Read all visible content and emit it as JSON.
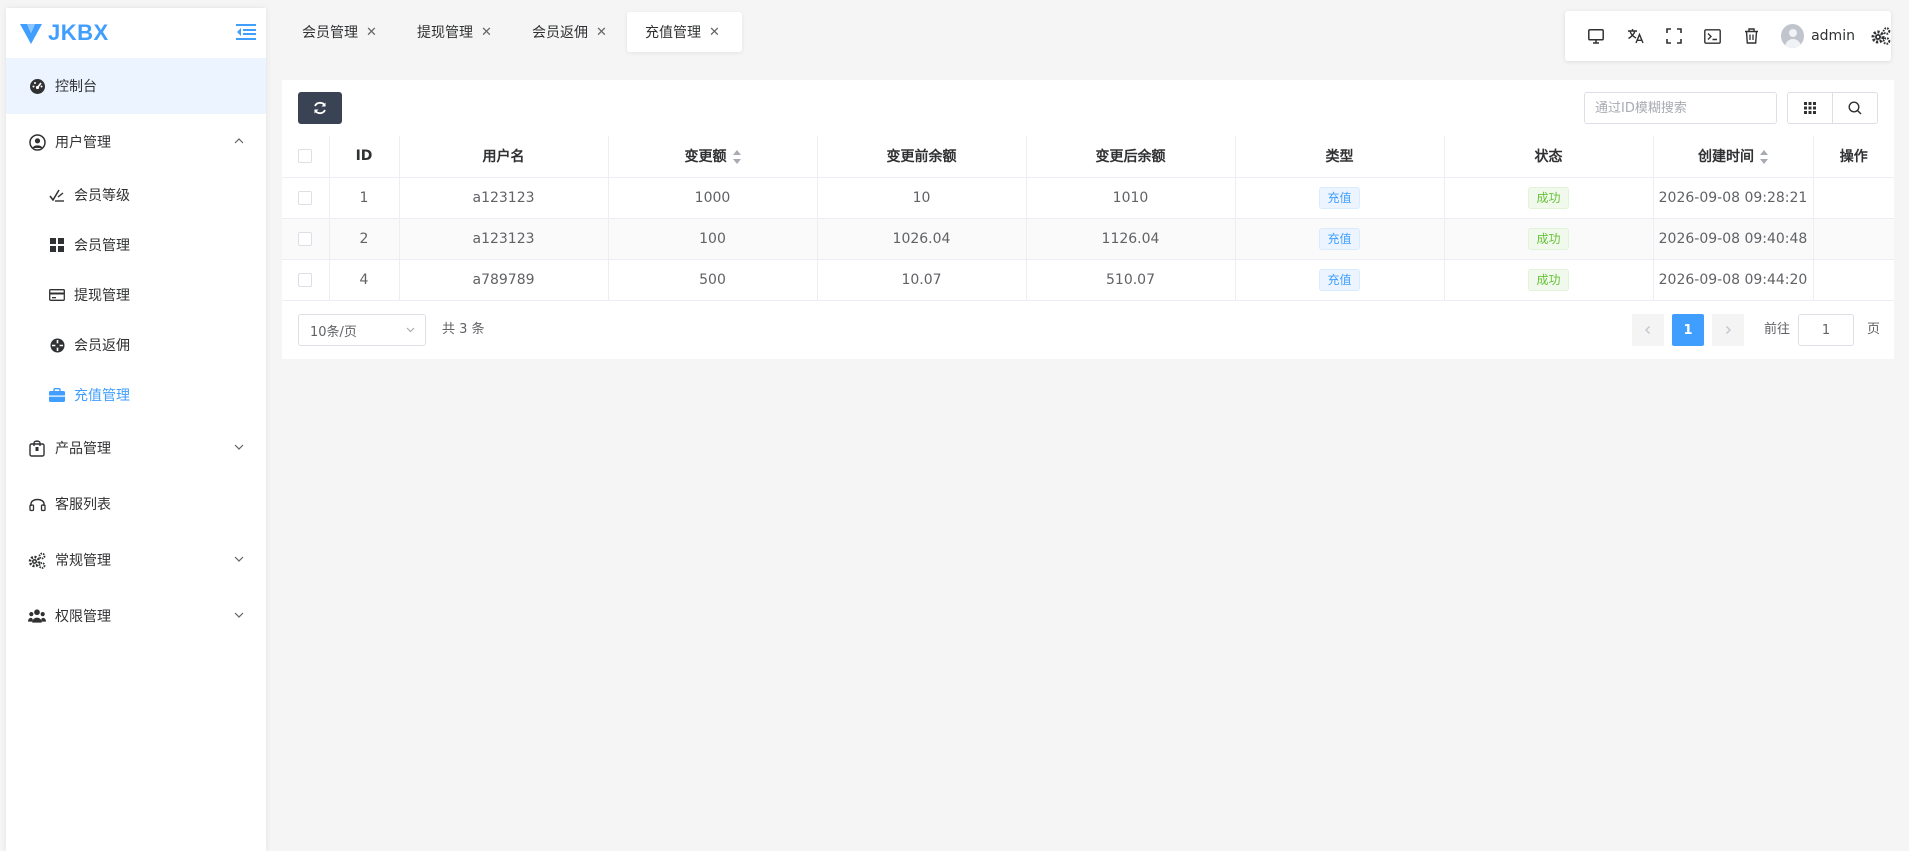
{
  "app": {
    "logo_text": "JKBX",
    "brand_color": "#409eff"
  },
  "sidebar": {
    "items": [
      {
        "label": "控制台",
        "icon": "dashboard-icon"
      },
      {
        "label": "用户管理",
        "icon": "user-circle-icon",
        "expanded": true,
        "children": [
          {
            "label": "会员等级",
            "icon": "level-icon"
          },
          {
            "label": "会员管理",
            "icon": "grid-icon"
          },
          {
            "label": "提现管理",
            "icon": "credit-card-icon"
          },
          {
            "label": "会员返佣",
            "icon": "rebate-icon"
          },
          {
            "label": "充值管理",
            "icon": "briefcase-icon",
            "active": true
          }
        ]
      },
      {
        "label": "产品管理",
        "icon": "product-bag-icon"
      },
      {
        "label": "客服列表",
        "icon": "headset-icon"
      },
      {
        "label": "常规管理",
        "icon": "gears-icon"
      },
      {
        "label": "权限管理",
        "icon": "users-icon"
      }
    ]
  },
  "tabs": [
    {
      "label": "会员管理"
    },
    {
      "label": "提现管理"
    },
    {
      "label": "会员返佣"
    },
    {
      "label": "充值管理",
      "active": true
    }
  ],
  "toolbar": {
    "username": "admin"
  },
  "search": {
    "placeholder": "通过ID模糊搜索"
  },
  "table": {
    "headers": [
      "ID",
      "用户名",
      "变更额",
      "变更前余额",
      "变更后余额",
      "类型",
      "状态",
      "创建时间",
      "操作"
    ],
    "rows": [
      {
        "id": "1",
        "username": "a123123",
        "amount": "1000",
        "before": "10",
        "after": "1010",
        "type": "充值",
        "status": "成功",
        "created": "2026-09-08 09:28:21"
      },
      {
        "id": "2",
        "username": "a123123",
        "amount": "100",
        "before": "1026.04",
        "after": "1126.04",
        "type": "充值",
        "status": "成功",
        "created": "2026-09-08 09:40:48"
      },
      {
        "id": "4",
        "username": "a789789",
        "amount": "500",
        "before": "10.07",
        "after": "510.07",
        "type": "充值",
        "status": "成功",
        "created": "2026-09-08 09:44:20"
      }
    ]
  },
  "pagination": {
    "page_size": "10条/页",
    "total": "共 3 条",
    "current_page": "1",
    "goto_label": "前往",
    "goto_value": "1",
    "page_suffix": "页"
  }
}
